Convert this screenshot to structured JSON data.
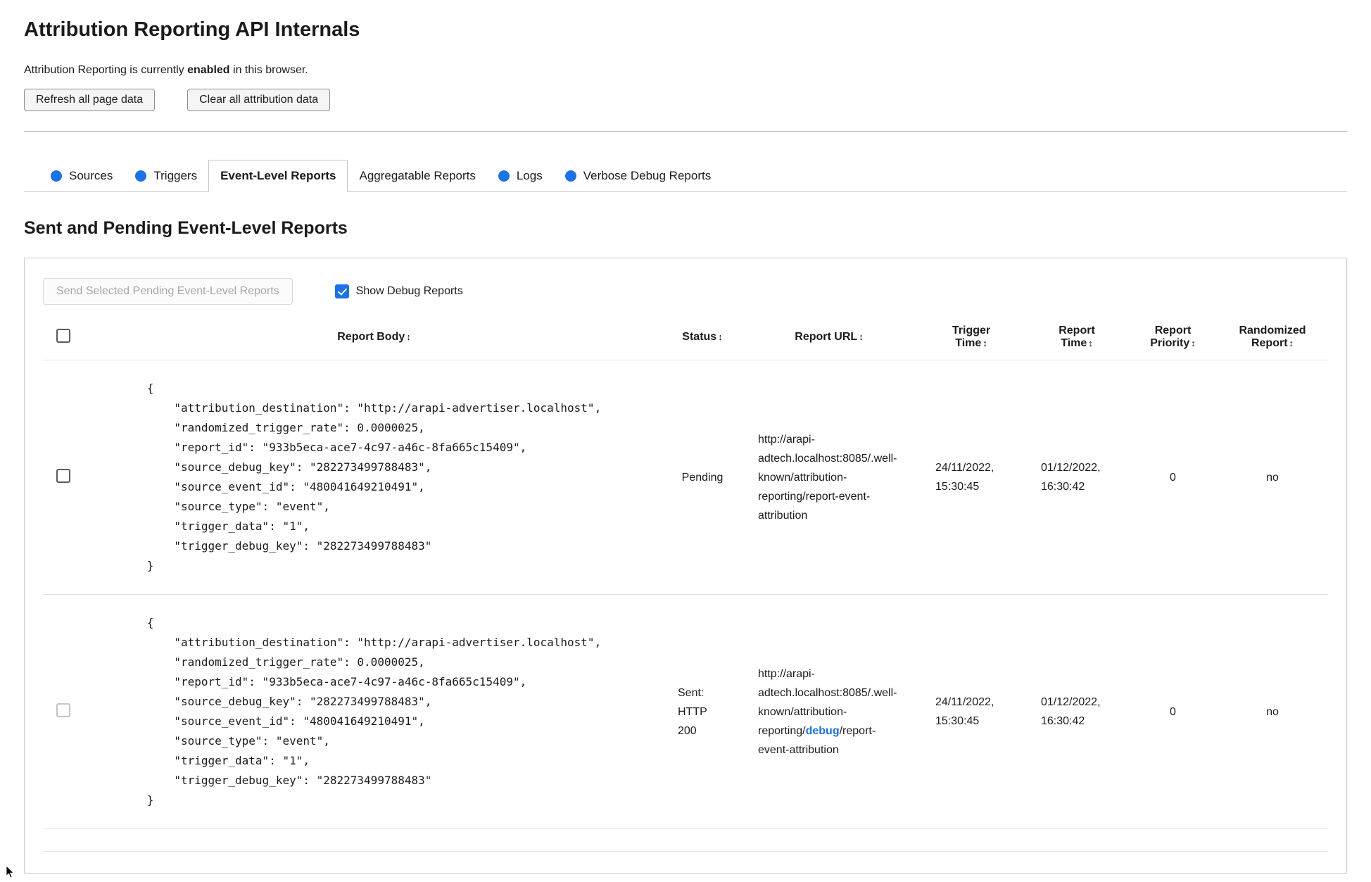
{
  "page": {
    "title": "Attribution Reporting API Internals",
    "status": {
      "prefix": "Attribution Reporting is currently ",
      "emphasis": "enabled",
      "suffix": " in this browser."
    },
    "buttons": {
      "refresh": "Refresh all page data",
      "clear": "Clear all attribution data"
    }
  },
  "tabs": [
    {
      "label": "Sources",
      "has_dot": true,
      "active": false
    },
    {
      "label": "Triggers",
      "has_dot": true,
      "active": false
    },
    {
      "label": "Event-Level Reports",
      "has_dot": false,
      "active": true
    },
    {
      "label": "Aggregatable Reports",
      "has_dot": false,
      "active": false
    },
    {
      "label": "Logs",
      "has_dot": true,
      "active": false
    },
    {
      "label": "Verbose Debug Reports",
      "has_dot": true,
      "active": false
    }
  ],
  "colors": {
    "accent_blue": "#1a73e8"
  },
  "section": {
    "heading": "Sent and Pending Event-Level Reports",
    "send_button": "Send Selected Pending Event-Level Reports",
    "send_button_disabled": true,
    "show_debug": {
      "label": "Show Debug Reports",
      "checked": true
    }
  },
  "table": {
    "sort_icon": "↕",
    "select_all_checked": false,
    "headers": [
      "Report Body",
      "Status",
      "Report URL",
      "Trigger Time",
      "Report Time",
      "Report Priority",
      "Randomized Report"
    ],
    "rows": [
      {
        "selected": false,
        "checkbox_disabled": false,
        "report_body": "{\n    \"attribution_destination\": \"http://arapi-advertiser.localhost\",\n    \"randomized_trigger_rate\": 0.0000025,\n    \"report_id\": \"933b5eca-ace7-4c97-a46c-8fa665c15409\",\n    \"source_debug_key\": \"282273499788483\",\n    \"source_event_id\": \"480041649210491\",\n    \"source_type\": \"event\",\n    \"trigger_data\": \"1\",\n    \"trigger_debug_key\": \"282273499788483\"\n}",
        "status": "Pending",
        "report_url": {
          "prefix": "http://arapi-adtech.localhost:8085/.well-known/attribution-reporting/report-event-attribution",
          "highlight": "",
          "suffix": ""
        },
        "trigger_time": "24/11/2022, 15:30:45",
        "report_time": "01/12/2022, 16:30:42",
        "report_priority": "0",
        "randomized_report": "no"
      },
      {
        "selected": false,
        "checkbox_disabled": true,
        "report_body": "{\n    \"attribution_destination\": \"http://arapi-advertiser.localhost\",\n    \"randomized_trigger_rate\": 0.0000025,\n    \"report_id\": \"933b5eca-ace7-4c97-a46c-8fa665c15409\",\n    \"source_debug_key\": \"282273499788483\",\n    \"source_event_id\": \"480041649210491\",\n    \"source_type\": \"event\",\n    \"trigger_data\": \"1\",\n    \"trigger_debug_key\": \"282273499788483\"\n}",
        "status": "Sent: HTTP 200",
        "report_url": {
          "prefix": "http://arapi-adtech.localhost:8085/.well-known/attribution-reporting/",
          "highlight": "debug",
          "suffix": "/report-event-attribution"
        },
        "trigger_time": "24/11/2022, 15:30:45",
        "report_time": "01/12/2022, 16:30:42",
        "report_priority": "0",
        "randomized_report": "no"
      }
    ]
  }
}
